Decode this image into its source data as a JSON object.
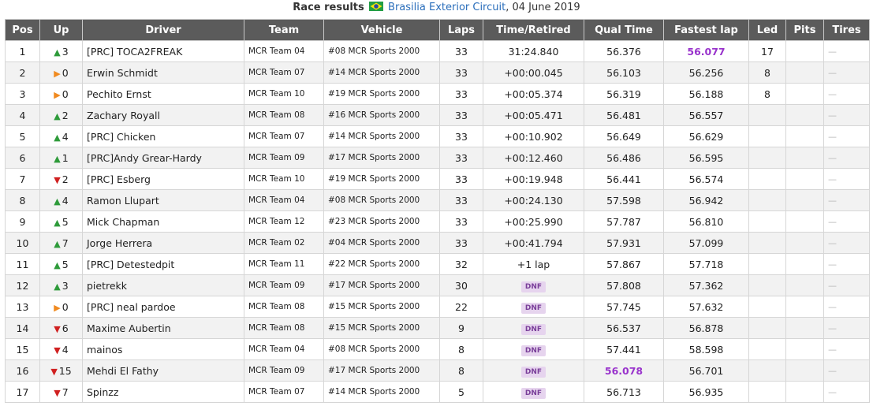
{
  "caption": {
    "title": "Race results",
    "circuit": "Brasilia Exterior Circuit",
    "date_text": ", 04 June 2019",
    "flag_icon": "brazil-flag-icon"
  },
  "colors": {
    "header_bg": "#5b5b5b",
    "up": "#2e9b3a",
    "down": "#d02020",
    "same": "#f08a20",
    "fastest": "#9933cc",
    "dnf_bg": "#e6d4ee"
  },
  "columns": [
    "Pos",
    "Up",
    "Driver",
    "Team",
    "Vehicle",
    "Laps",
    "Time/Retired",
    "Qual Time",
    "Fastest lap",
    "Led",
    "Pits",
    "Tires"
  ],
  "rows": [
    {
      "pos": "1",
      "dir": "up",
      "up": "3",
      "driver": "[PRC] TOCA2FREAK",
      "team": "MCR Team 04",
      "vehicle": "#08 MCR Sports 2000",
      "laps": "33",
      "time": "31:24.840",
      "qual": "56.376",
      "fast": "56.077",
      "led": "17",
      "pits": "",
      "tires": "—"
    },
    {
      "pos": "2",
      "dir": "same",
      "up": "0",
      "driver": "Erwin Schmidt",
      "team": "MCR Team 07",
      "vehicle": "#14 MCR Sports 2000",
      "laps": "33",
      "time": "+00:00.045",
      "qual": "56.103",
      "fast": "56.256",
      "led": "8",
      "pits": "",
      "tires": "—"
    },
    {
      "pos": "3",
      "dir": "same",
      "up": "0",
      "driver": "Pechito Ernst",
      "team": "MCR Team 10",
      "vehicle": "#19 MCR Sports 2000",
      "laps": "33",
      "time": "+00:05.374",
      "qual": "56.319",
      "fast": "56.188",
      "led": "8",
      "pits": "",
      "tires": "—"
    },
    {
      "pos": "4",
      "dir": "up",
      "up": "2",
      "driver": "Zachary Royall",
      "team": "MCR Team 08",
      "vehicle": "#16 MCR Sports 2000",
      "laps": "33",
      "time": "+00:05.471",
      "qual": "56.481",
      "fast": "56.557",
      "led": "",
      "pits": "",
      "tires": "—"
    },
    {
      "pos": "5",
      "dir": "up",
      "up": "4",
      "driver": "[PRC] Chicken",
      "team": "MCR Team 07",
      "vehicle": "#14 MCR Sports 2000",
      "laps": "33",
      "time": "+00:10.902",
      "qual": "56.649",
      "fast": "56.629",
      "led": "",
      "pits": "",
      "tires": "—"
    },
    {
      "pos": "6",
      "dir": "up",
      "up": "1",
      "driver": "[PRC]Andy Grear-Hardy",
      "team": "MCR Team 09",
      "vehicle": "#17 MCR Sports 2000",
      "laps": "33",
      "time": "+00:12.460",
      "qual": "56.486",
      "fast": "56.595",
      "led": "",
      "pits": "",
      "tires": "—"
    },
    {
      "pos": "7",
      "dir": "down",
      "up": "2",
      "driver": "[PRC] Esberg",
      "team": "MCR Team 10",
      "vehicle": "#19 MCR Sports 2000",
      "laps": "33",
      "time": "+00:19.948",
      "qual": "56.441",
      "fast": "56.574",
      "led": "",
      "pits": "",
      "tires": "—"
    },
    {
      "pos": "8",
      "dir": "up",
      "up": "4",
      "driver": "Ramon Llupart",
      "team": "MCR Team 04",
      "vehicle": "#08 MCR Sports 2000",
      "laps": "33",
      "time": "+00:24.130",
      "qual": "57.598",
      "fast": "56.942",
      "led": "",
      "pits": "",
      "tires": "—"
    },
    {
      "pos": "9",
      "dir": "up",
      "up": "5",
      "driver": "Mick Chapman",
      "team": "MCR Team 12",
      "vehicle": "#23 MCR Sports 2000",
      "laps": "33",
      "time": "+00:25.990",
      "qual": "57.787",
      "fast": "56.810",
      "led": "",
      "pits": "",
      "tires": "—"
    },
    {
      "pos": "10",
      "dir": "up",
      "up": "7",
      "driver": "Jorge Herrera",
      "team": "MCR Team 02",
      "vehicle": "#04 MCR Sports 2000",
      "laps": "33",
      "time": "+00:41.794",
      "qual": "57.931",
      "fast": "57.099",
      "led": "",
      "pits": "",
      "tires": "—"
    },
    {
      "pos": "11",
      "dir": "up",
      "up": "5",
      "driver": "[PRC] Detestedpit",
      "team": "MCR Team 11",
      "vehicle": "#22 MCR Sports 2000",
      "laps": "32",
      "time": "+1 lap",
      "qual": "57.867",
      "fast": "57.718",
      "led": "",
      "pits": "",
      "tires": "—"
    },
    {
      "pos": "12",
      "dir": "up",
      "up": "3",
      "driver": "pietrekk",
      "team": "MCR Team 09",
      "vehicle": "#17 MCR Sports 2000",
      "laps": "30",
      "time": "DNF",
      "qual": "57.808",
      "fast": "57.362",
      "led": "",
      "pits": "",
      "tires": "—"
    },
    {
      "pos": "13",
      "dir": "same",
      "up": "0",
      "driver": "[PRC] neal pardoe",
      "team": "MCR Team 08",
      "vehicle": "#15 MCR Sports 2000",
      "laps": "22",
      "time": "DNF",
      "qual": "57.745",
      "fast": "57.632",
      "led": "",
      "pits": "",
      "tires": "—"
    },
    {
      "pos": "14",
      "dir": "down",
      "up": "6",
      "driver": "Maxime Aubertin",
      "team": "MCR Team 08",
      "vehicle": "#15 MCR Sports 2000",
      "laps": "9",
      "time": "DNF",
      "qual": "56.537",
      "fast": "56.878",
      "led": "",
      "pits": "",
      "tires": "—"
    },
    {
      "pos": "15",
      "dir": "down",
      "up": "4",
      "driver": "mainos",
      "team": "MCR Team 04",
      "vehicle": "#08 MCR Sports 2000",
      "laps": "8",
      "time": "DNF",
      "qual": "57.441",
      "fast": "58.598",
      "led": "",
      "pits": "",
      "tires": "—"
    },
    {
      "pos": "16",
      "dir": "down",
      "up": "15",
      "driver": "Mehdi El Fathy",
      "team": "MCR Team 09",
      "vehicle": "#17 MCR Sports 2000",
      "laps": "8",
      "time": "DNF",
      "qual": "56.078",
      "fast": "56.701",
      "led": "",
      "pits": "",
      "tires": "—"
    },
    {
      "pos": "17",
      "dir": "down",
      "up": "7",
      "driver": "Spinzz",
      "team": "MCR Team 07",
      "vehicle": "#14 MCR Sports 2000",
      "laps": "5",
      "time": "DNF",
      "qual": "56.713",
      "fast": "56.935",
      "led": "",
      "pits": "",
      "tires": "—"
    }
  ],
  "highlights": {
    "fastest_lap_row": 0,
    "best_qual_row": 15
  }
}
